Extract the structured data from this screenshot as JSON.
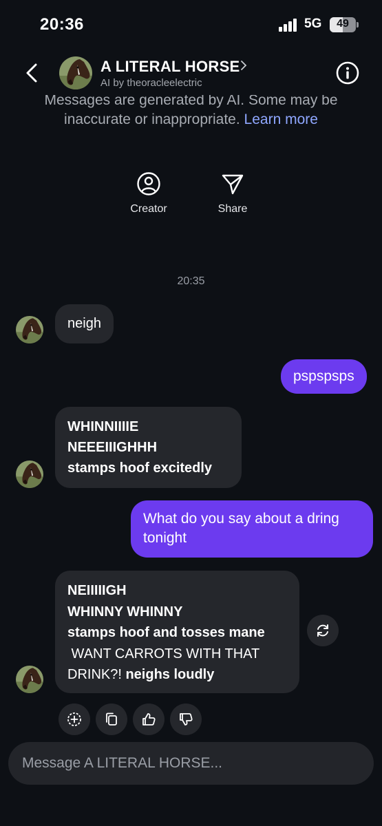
{
  "status_bar": {
    "time": "20:36",
    "network": "5G",
    "battery": "49",
    "battery_level": 0.49
  },
  "header": {
    "title": "A LITERAL HORSE",
    "subtitle": "AI by theoracleelectric",
    "back_icon": "chevron-left-icon",
    "info_icon": "info-icon"
  },
  "disclaimer": {
    "text": "Messages are generated by AI. Some may be inaccurate or inappropriate.",
    "link": "Learn more"
  },
  "actions": {
    "creator": "Creator",
    "share": "Share"
  },
  "timestamp": "20:35",
  "messages": [
    {
      "from": "ai",
      "text": "neigh"
    },
    {
      "from": "user",
      "text": "pspspsps"
    },
    {
      "from": "ai",
      "lines": [
        "WHINNIIIIE",
        "NEEEIIIGHHH",
        "stamps hoof excitedly"
      ]
    },
    {
      "from": "user",
      "text": "What do you say about a dring tonight"
    },
    {
      "from": "ai",
      "lines": [
        "NEIIIIIGH",
        "WHINNY WHINNY",
        "stamps hoof and tosses mane",
        " WANT CARROTS WITH THAT",
        "DRINK?!",
        "neighs loudly"
      ]
    }
  ],
  "message_actions": [
    "add-reaction-icon",
    "copy-icon",
    "thumbs-up-icon",
    "thumbs-down-icon"
  ],
  "composer": {
    "placeholder": "Message A LITERAL HORSE..."
  },
  "colors": {
    "background": "#0d1015",
    "user_bubble": "#6c3bef",
    "ai_bubble": "#25272c",
    "link": "#8fa7ff"
  }
}
